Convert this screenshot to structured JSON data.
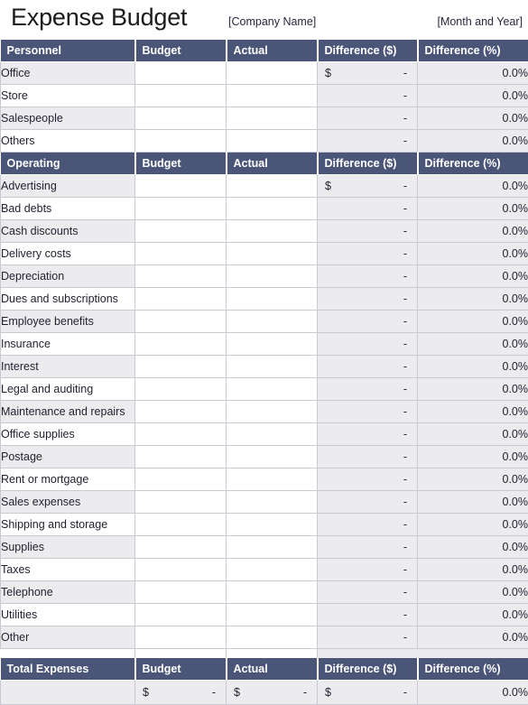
{
  "header": {
    "title": "Expense Budget",
    "company_placeholder": "[Company Name]",
    "period_placeholder": "[Month and Year]"
  },
  "columns": {
    "budget": "Budget",
    "actual": "Actual",
    "difference_dollars": "Difference ($)",
    "difference_percent": "Difference (%)"
  },
  "values": {
    "currency_symbol": "$",
    "dash": "-",
    "zero_percent": "0.0%",
    "blank": ""
  },
  "colors": {
    "header_blue": "#4a5578",
    "row_stripe": "#ececef",
    "calc_cell": "#ececef",
    "grid_line": "#c9c9d2",
    "page_background": "#ffffff",
    "text": "#211f2e"
  },
  "sections": [
    {
      "name": "personnel",
      "heading": "Personnel",
      "rows": [
        {
          "label": "Office",
          "budget": "",
          "actual": "",
          "diff_currency": "$",
          "diff_dash": "-",
          "diff_pct": "0.0%"
        },
        {
          "label": "Store",
          "budget": "",
          "actual": "",
          "diff_currency": "",
          "diff_dash": "-",
          "diff_pct": "0.0%"
        },
        {
          "label": "Salespeople",
          "budget": "",
          "actual": "",
          "diff_currency": "",
          "diff_dash": "-",
          "diff_pct": "0.0%"
        },
        {
          "label": "Others",
          "budget": "",
          "actual": "",
          "diff_currency": "",
          "diff_dash": "-",
          "diff_pct": "0.0%"
        }
      ]
    },
    {
      "name": "operating",
      "heading": "Operating",
      "rows": [
        {
          "label": "Advertising",
          "budget": "",
          "actual": "",
          "diff_currency": "$",
          "diff_dash": "-",
          "diff_pct": "0.0%"
        },
        {
          "label": "Bad debts",
          "budget": "",
          "actual": "",
          "diff_currency": "",
          "diff_dash": "-",
          "diff_pct": "0.0%"
        },
        {
          "label": "Cash discounts",
          "budget": "",
          "actual": "",
          "diff_currency": "",
          "diff_dash": "-",
          "diff_pct": "0.0%"
        },
        {
          "label": "Delivery costs",
          "budget": "",
          "actual": "",
          "diff_currency": "",
          "diff_dash": "-",
          "diff_pct": "0.0%"
        },
        {
          "label": "Depreciation",
          "budget": "",
          "actual": "",
          "diff_currency": "",
          "diff_dash": "-",
          "diff_pct": "0.0%"
        },
        {
          "label": "Dues and subscriptions",
          "budget": "",
          "actual": "",
          "diff_currency": "",
          "diff_dash": "-",
          "diff_pct": "0.0%"
        },
        {
          "label": "Employee benefits",
          "budget": "",
          "actual": "",
          "diff_currency": "",
          "diff_dash": "-",
          "diff_pct": "0.0%"
        },
        {
          "label": "Insurance",
          "budget": "",
          "actual": "",
          "diff_currency": "",
          "diff_dash": "-",
          "diff_pct": "0.0%"
        },
        {
          "label": "Interest",
          "budget": "",
          "actual": "",
          "diff_currency": "",
          "diff_dash": "-",
          "diff_pct": "0.0%"
        },
        {
          "label": "Legal and auditing",
          "budget": "",
          "actual": "",
          "diff_currency": "",
          "diff_dash": "-",
          "diff_pct": "0.0%"
        },
        {
          "label": "Maintenance and repairs",
          "budget": "",
          "actual": "",
          "diff_currency": "",
          "diff_dash": "-",
          "diff_pct": "0.0%"
        },
        {
          "label": "Office supplies",
          "budget": "",
          "actual": "",
          "diff_currency": "",
          "diff_dash": "-",
          "diff_pct": "0.0%"
        },
        {
          "label": "Postage",
          "budget": "",
          "actual": "",
          "diff_currency": "",
          "diff_dash": "-",
          "diff_pct": "0.0%"
        },
        {
          "label": "Rent or mortgage",
          "budget": "",
          "actual": "",
          "diff_currency": "",
          "diff_dash": "-",
          "diff_pct": "0.0%"
        },
        {
          "label": "Sales expenses",
          "budget": "",
          "actual": "",
          "diff_currency": "",
          "diff_dash": "-",
          "diff_pct": "0.0%"
        },
        {
          "label": "Shipping and storage",
          "budget": "",
          "actual": "",
          "diff_currency": "",
          "diff_dash": "-",
          "diff_pct": "0.0%"
        },
        {
          "label": "Supplies",
          "budget": "",
          "actual": "",
          "diff_currency": "",
          "diff_dash": "-",
          "diff_pct": "0.0%"
        },
        {
          "label": "Taxes",
          "budget": "",
          "actual": "",
          "diff_currency": "",
          "diff_dash": "-",
          "diff_pct": "0.0%"
        },
        {
          "label": "Telephone",
          "budget": "",
          "actual": "",
          "diff_currency": "",
          "diff_dash": "-",
          "diff_pct": "0.0%"
        },
        {
          "label": "Utilities",
          "budget": "",
          "actual": "",
          "diff_currency": "",
          "diff_dash": "-",
          "diff_pct": "0.0%"
        },
        {
          "label": "Other",
          "budget": "",
          "actual": "",
          "diff_currency": "",
          "diff_dash": "-",
          "diff_pct": "0.0%"
        }
      ]
    }
  ],
  "total": {
    "heading": "Total  Expenses",
    "row": {
      "budget_currency": "$",
      "budget_dash": "-",
      "actual_currency": "$",
      "actual_dash": "-",
      "diff_currency": "$",
      "diff_dash": "-",
      "diff_pct": "0.0%"
    }
  }
}
